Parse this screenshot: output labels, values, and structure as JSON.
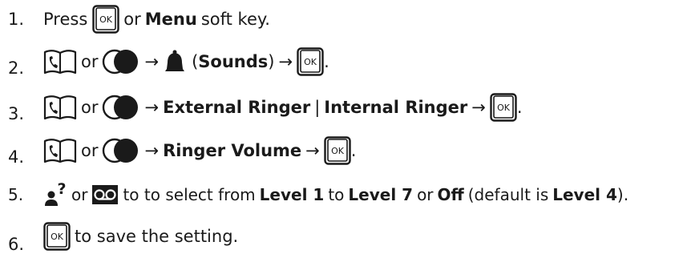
{
  "steps": [
    {
      "num": "1.",
      "press": "Press",
      "or": "or",
      "menu": "Menu",
      "softkey": "soft key."
    },
    {
      "num": "2.",
      "or": "or",
      "arrow1": "→",
      "paren_open": "(",
      "sounds": "Sounds",
      "paren_close": ")",
      "arrow2": "→",
      "end": "."
    },
    {
      "num": "3.",
      "or": "or",
      "arrow1": "→",
      "external": "External Ringer",
      "sep": "|",
      "internal": "Internal Ringer",
      "arrow2": "→",
      "end": "."
    },
    {
      "num": "4.",
      "or": "or",
      "arrow1": "→",
      "volume": "Ringer Volume",
      "arrow2": "→",
      "end": "."
    },
    {
      "num": "5.",
      "or": "or",
      "t1": "to to select from",
      "level1": "Level 1",
      "to": "to",
      "level7": "Level 7",
      "or2": "or",
      "off": "Off",
      "default_open": "(default is",
      "level4": "Level 4",
      "default_close": ")."
    },
    {
      "num": "6.",
      "t1": "to save the setting."
    }
  ],
  "ok_key_label": "OK",
  "icons": [
    "ok-key-icon",
    "phonebook-icon",
    "caller-id-icon",
    "bell-icon",
    "intercom-icon",
    "answering-machine-icon"
  ]
}
